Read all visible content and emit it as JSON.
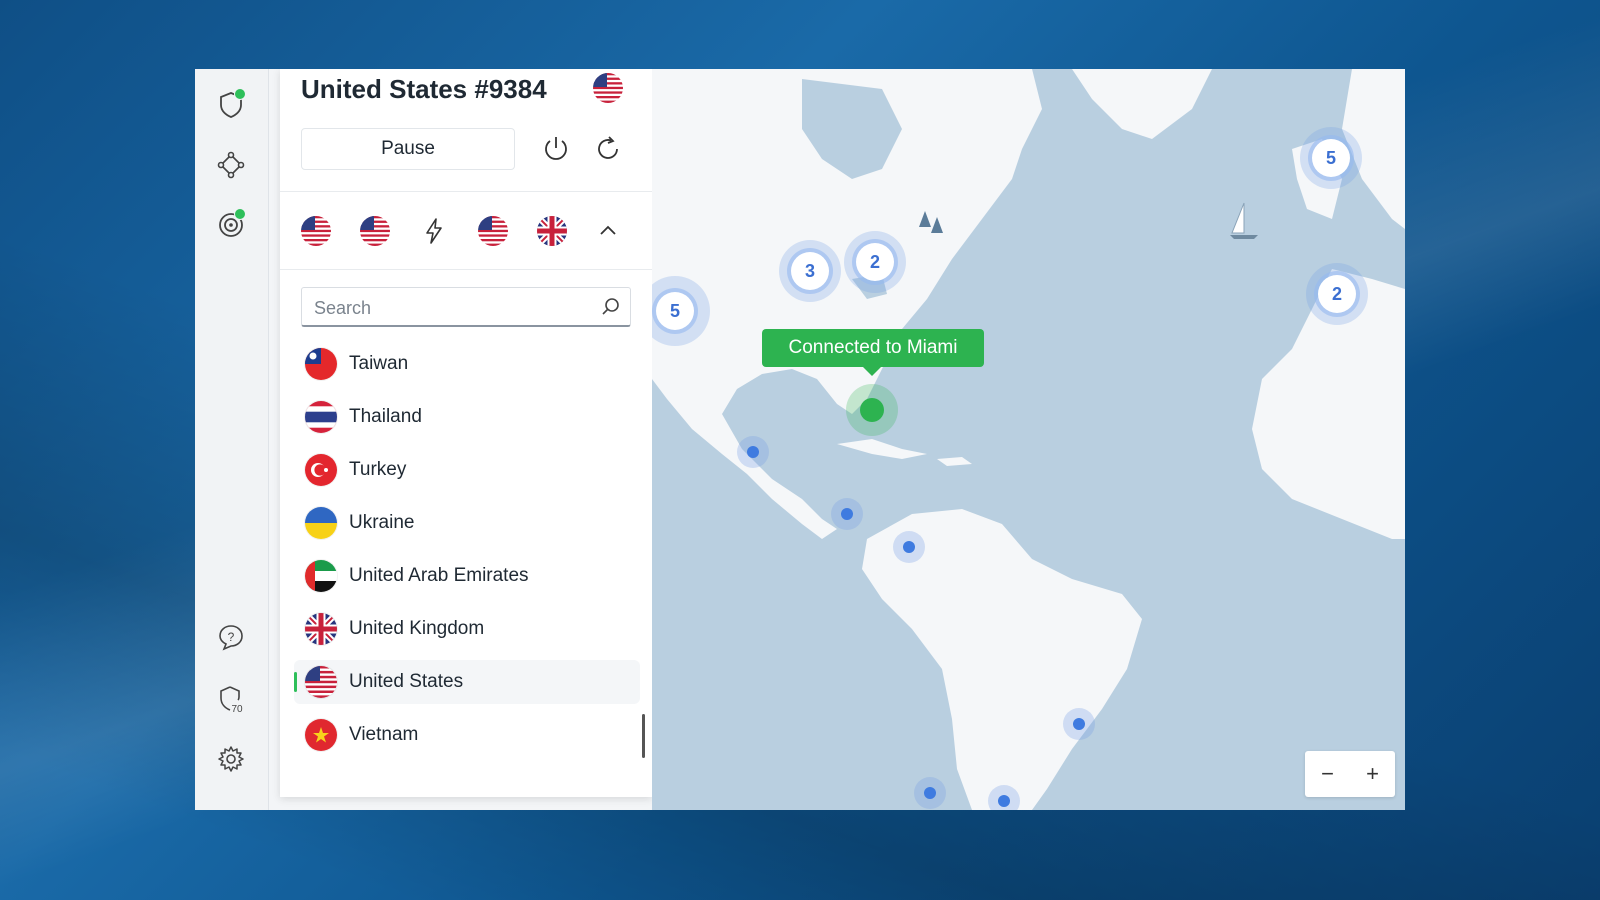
{
  "server": {
    "title": "United States #9384",
    "flag": "us"
  },
  "controls": {
    "pause_label": "Pause"
  },
  "quick_connect": [
    {
      "flag": "us"
    },
    {
      "flag": "us"
    },
    {
      "icon": "lightning-icon"
    },
    {
      "flag": "us"
    },
    {
      "flag": "gb"
    }
  ],
  "search": {
    "placeholder": "Search"
  },
  "countries": [
    {
      "name": "Taiwan",
      "flag": "tw"
    },
    {
      "name": "Thailand",
      "flag": "th"
    },
    {
      "name": "Turkey",
      "flag": "tr"
    },
    {
      "name": "Ukraine",
      "flag": "ua"
    },
    {
      "name": "United Arab Emirates",
      "flag": "ae"
    },
    {
      "name": "United Kingdom",
      "flag": "gb"
    },
    {
      "name": "United States",
      "flag": "us",
      "active": true
    },
    {
      "name": "Vietnam",
      "flag": "vn"
    }
  ],
  "map": {
    "tooltip": "Connected to Miami",
    "clusters": [
      {
        "count": "5",
        "region": "west-us"
      },
      {
        "count": "3",
        "region": "central-us"
      },
      {
        "count": "2",
        "region": "east-us"
      },
      {
        "count": "5",
        "region": "uk"
      },
      {
        "count": "2",
        "region": "portugal"
      }
    ],
    "zoom_out": "−",
    "zoom_in": "+"
  },
  "colors": {
    "accent_green": "#2db350",
    "map_water": "#b9cfe0",
    "map_land": "#f5f7f9",
    "server_blue": "#3f7be0"
  }
}
